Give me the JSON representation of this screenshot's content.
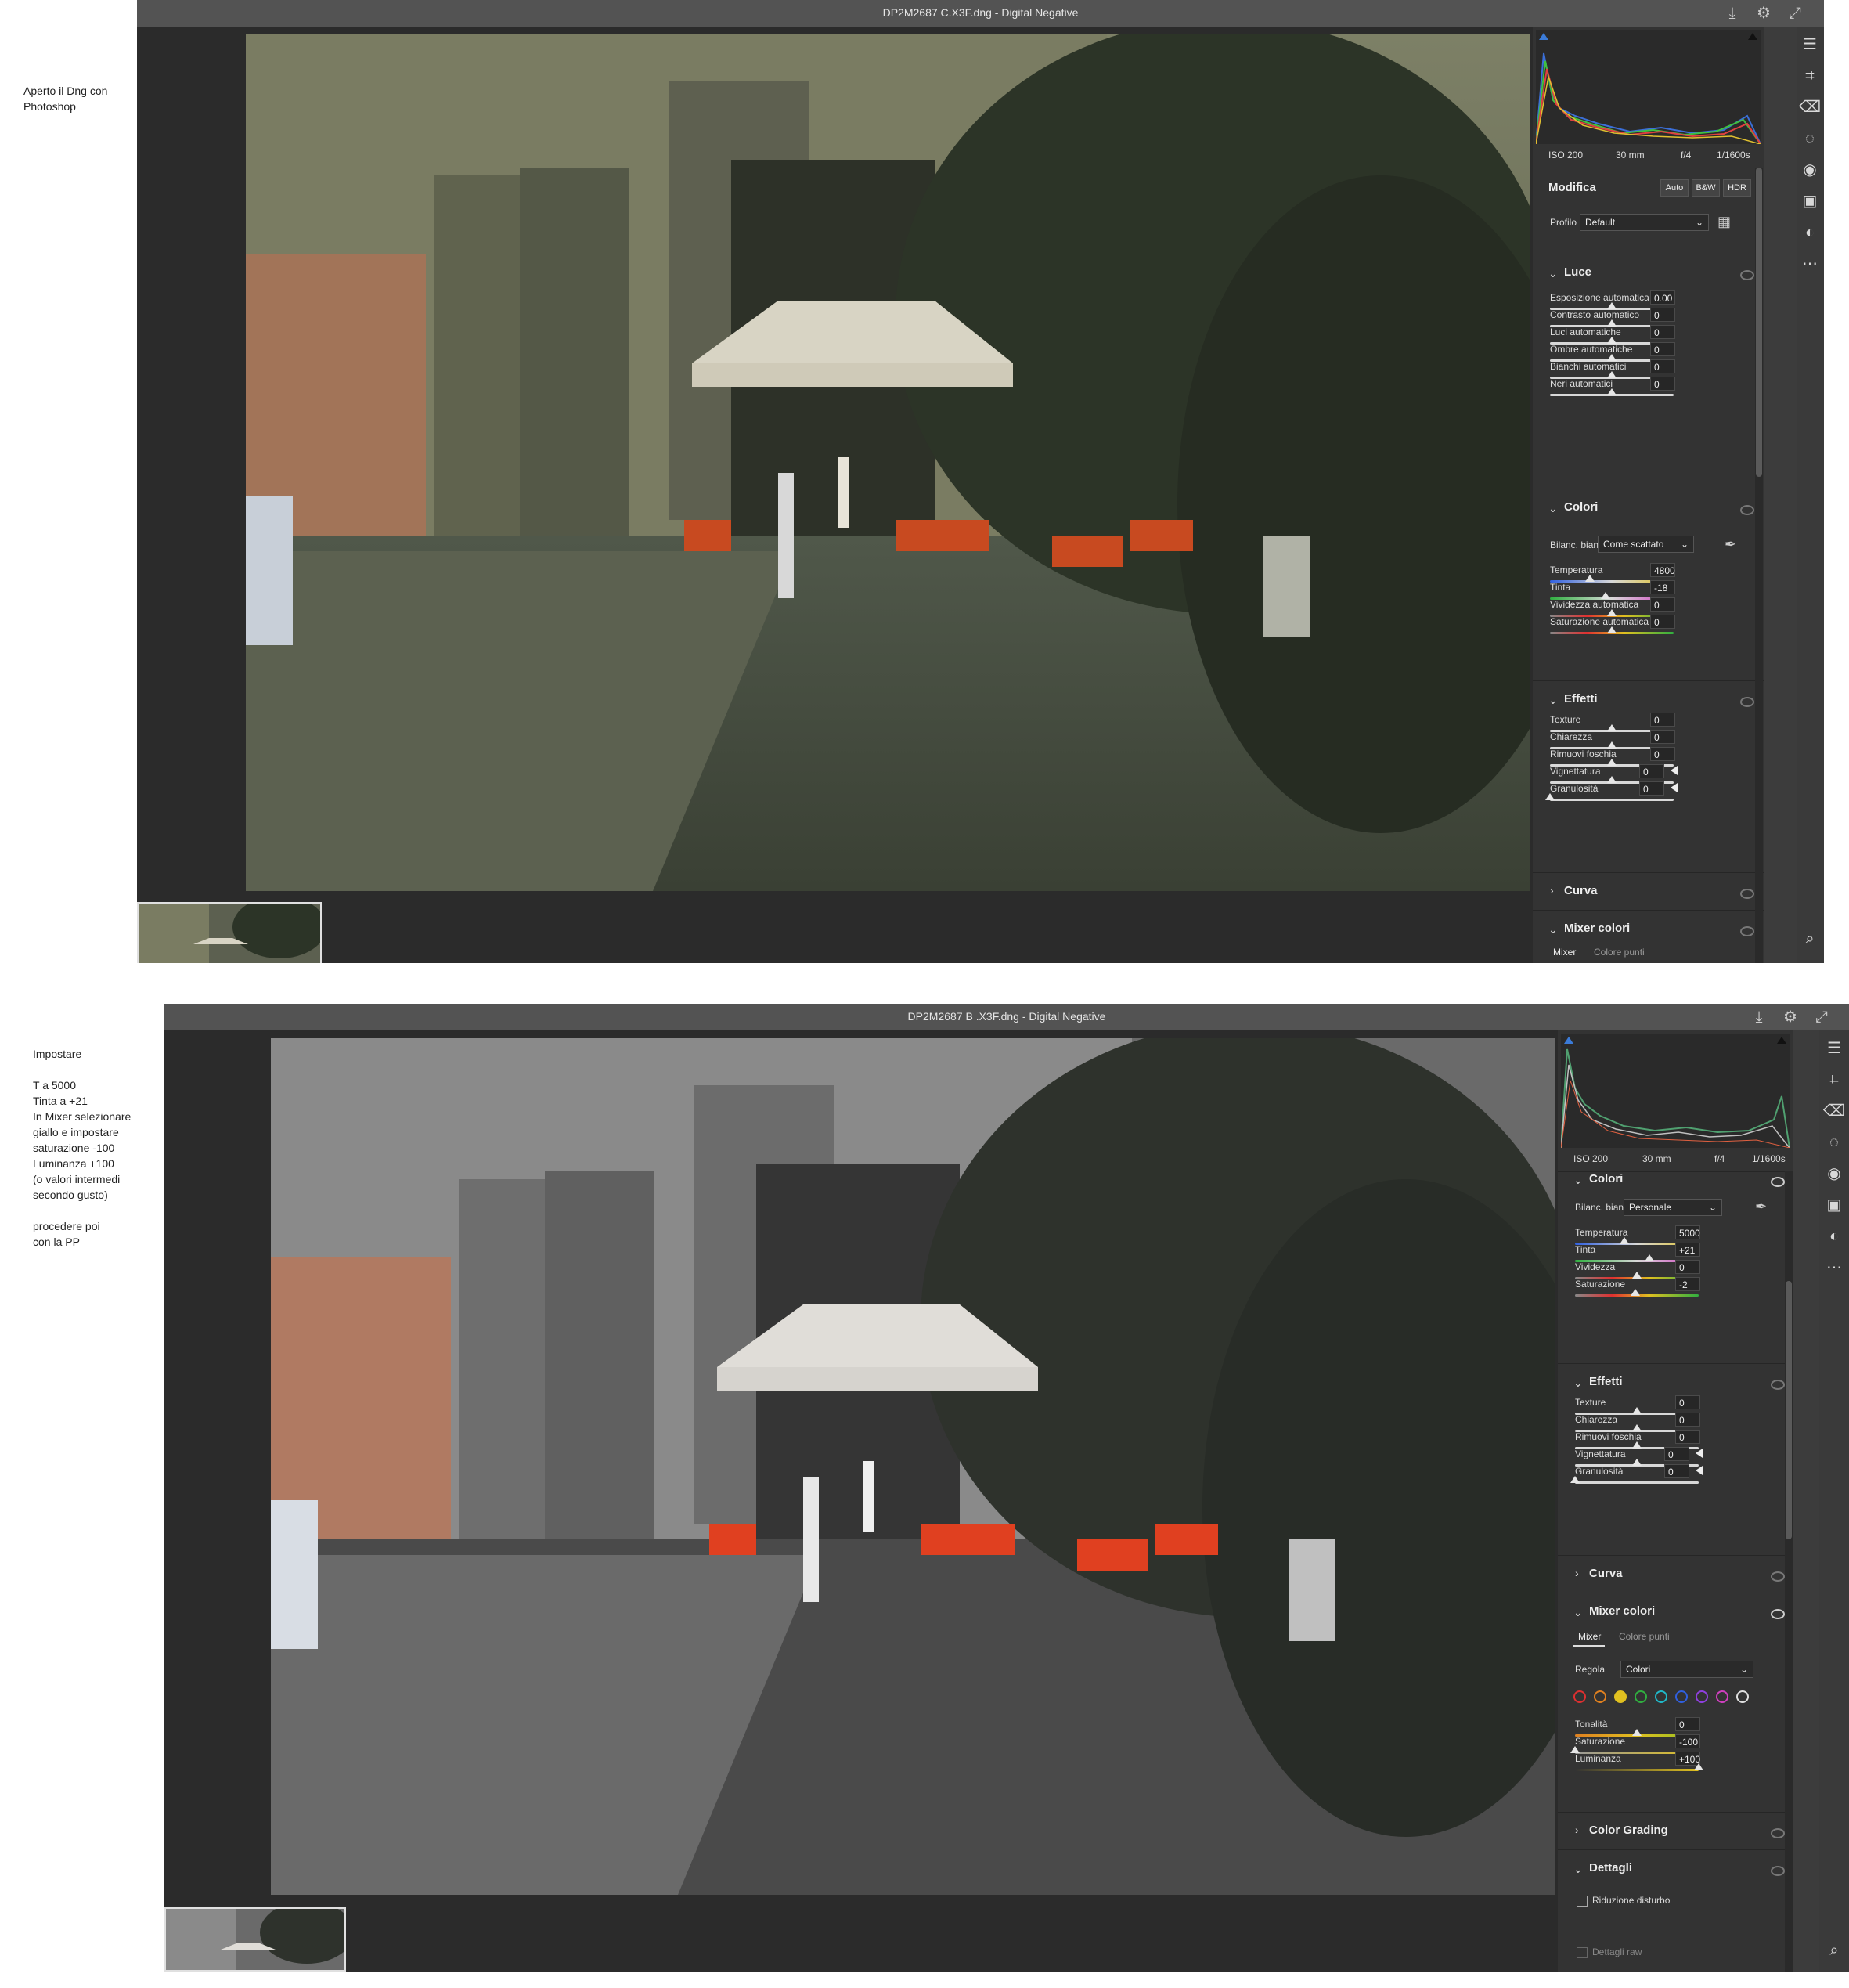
{
  "top": {
    "note": "Aperto il Dng con\nPhotoshop",
    "title": "DP2M2687  C.X3F.dng  -  Digital Negative",
    "meta": {
      "iso": "ISO 200",
      "focal": "30 mm",
      "aperture": "f/4",
      "shutter": "1/1600s"
    },
    "modifica": {
      "title": "Modifica",
      "auto": "Auto",
      "bw": "B&W",
      "hdr": "HDR"
    },
    "profile": {
      "label": "Profilo",
      "value": "Default"
    },
    "luce": {
      "title": "Luce",
      "rows": [
        {
          "label": "Esposizione automatica",
          "value": "0.00"
        },
        {
          "label": "Contrasto automatico",
          "value": "0"
        },
        {
          "label": "Luci automatiche",
          "value": "0"
        },
        {
          "label": "Ombre automatiche",
          "value": "0"
        },
        {
          "label": "Bianchi automatici",
          "value": "0"
        },
        {
          "label": "Neri automatici",
          "value": "0"
        }
      ]
    },
    "colori": {
      "title": "Colori",
      "wb_label": "Bilanc. bianco",
      "wb_value": "Come scattato",
      "rows": [
        {
          "label": "Temperatura",
          "value": "4800"
        },
        {
          "label": "Tinta",
          "value": "-18"
        },
        {
          "label": "Vividezza automatica",
          "value": "0"
        },
        {
          "label": "Saturazione automatica",
          "value": "0"
        }
      ]
    },
    "effetti": {
      "title": "Effetti",
      "rows": [
        {
          "label": "Texture",
          "value": "0"
        },
        {
          "label": "Chiarezza",
          "value": "0"
        },
        {
          "label": "Rimuovi foschia",
          "value": "0"
        },
        {
          "label": "Vignettatura",
          "value": "0"
        },
        {
          "label": "Granulosità",
          "value": "0"
        }
      ]
    },
    "curva": "Curva",
    "mixer": {
      "title": "Mixer colori",
      "tab1": "Mixer",
      "tab2": "Colore punti"
    }
  },
  "bottom": {
    "note": "Impostare\n\nT a 5000\nTinta a +21\nIn Mixer selezionare\ngiallo e impostare\nsaturazione -100\nLuminanza +100\n(o valori intermedi\nsecondo gusto)\n\nprocedere poi\ncon la PP",
    "title": "DP2M2687  B .X3F.dng  -  Digital Negative",
    "meta": {
      "iso": "ISO 200",
      "focal": "30 mm",
      "aperture": "f/4",
      "shutter": "1/1600s"
    },
    "colori": {
      "title": "Colori",
      "wb_label": "Bilanc. bianco",
      "wb_value": "Personale",
      "rows": [
        {
          "label": "Temperatura",
          "value": "5000"
        },
        {
          "label": "Tinta",
          "value": "+21"
        },
        {
          "label": "Vividezza",
          "value": "0"
        },
        {
          "label": "Saturazione",
          "value": "-2"
        }
      ]
    },
    "effetti": {
      "title": "Effetti",
      "rows": [
        {
          "label": "Texture",
          "value": "0"
        },
        {
          "label": "Chiarezza",
          "value": "0"
        },
        {
          "label": "Rimuovi foschia",
          "value": "0"
        },
        {
          "label": "Vignettatura",
          "value": "0"
        },
        {
          "label": "Granulosità",
          "value": "0"
        }
      ]
    },
    "curva": "Curva",
    "mixer": {
      "title": "Mixer colori",
      "tab1": "Mixer",
      "tab2": "Colore punti",
      "regola_label": "Regola",
      "regola_value": "Colori",
      "dots": [
        "#e03030",
        "#e08020",
        "#e0c020",
        "#30b040",
        "#20b8c8",
        "#3060e0",
        "#9040e0",
        "#d040c0",
        "#e0e0e0"
      ],
      "rows": [
        {
          "label": "Tonalità",
          "value": "0"
        },
        {
          "label": "Saturazione",
          "value": "-100"
        },
        {
          "label": "Luminanza",
          "value": "+100"
        }
      ]
    },
    "color_grading": "Color Grading",
    "dettagli": {
      "title": "Dettagli",
      "noise": "Riduzione disturbo",
      "raw": "Dettagli raw"
    }
  }
}
